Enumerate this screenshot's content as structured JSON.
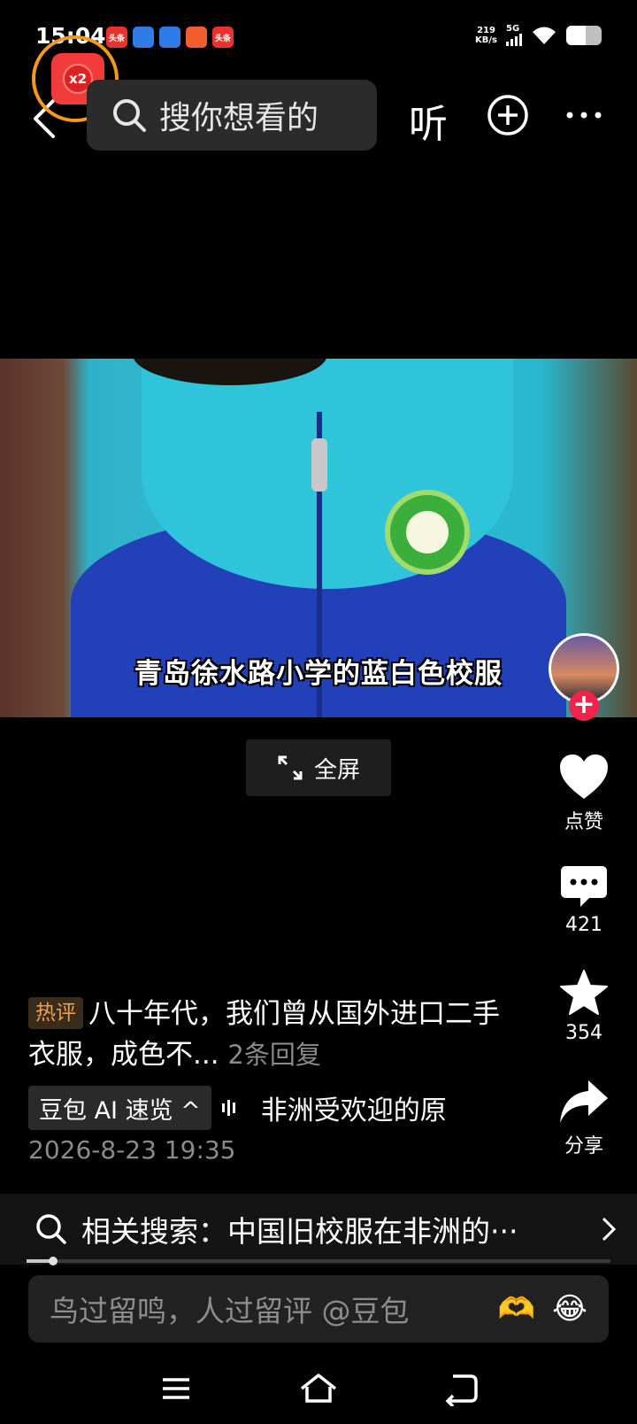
{
  "status_bar": {
    "time": "15:04",
    "notifications": [
      {
        "icon": "toutiao-icon",
        "label": "头条",
        "color": "#e8322d"
      },
      {
        "icon": "docs-icon",
        "label": "",
        "color": "#2f7be8"
      },
      {
        "icon": "browser-icon",
        "label": "",
        "color": "#2f7be8"
      },
      {
        "icon": "app-icon",
        "label": "",
        "color": "#f25d2e"
      },
      {
        "icon": "toutiao-icon",
        "label": "头条",
        "color": "#e8322d"
      }
    ],
    "net_speed_value": "219",
    "net_speed_unit": "KB/s",
    "signal_label": "5G",
    "battery_level": 0.55
  },
  "header": {
    "reward_badge": "x2",
    "search_placeholder": "搜你想看的",
    "listen_label": "听"
  },
  "video": {
    "subtitle": "青岛徐水路小学的蓝白色校服"
  },
  "fullscreen_label": "全屏",
  "actions": {
    "like_label": "点赞",
    "comment_count": "421",
    "favorite_count": "354",
    "share_label": "分享"
  },
  "description": {
    "hot_tag": "热评",
    "hot_comment": "八十年代，我们曾从国外进口二手衣服，成色不...",
    "replies": "2条回复",
    "ai_chip": "豆包 AI 速览 ^",
    "ai_text": "非洲受欢迎的原",
    "date": "2026-8-23 19:35"
  },
  "related_search": "相关搜索：中国旧校服在非洲的···",
  "progress": 0.045,
  "comment_input": {
    "placeholder": "鸟过留鸣，人过留评 @豆包",
    "emojis": [
      "🫶",
      "😂"
    ]
  }
}
